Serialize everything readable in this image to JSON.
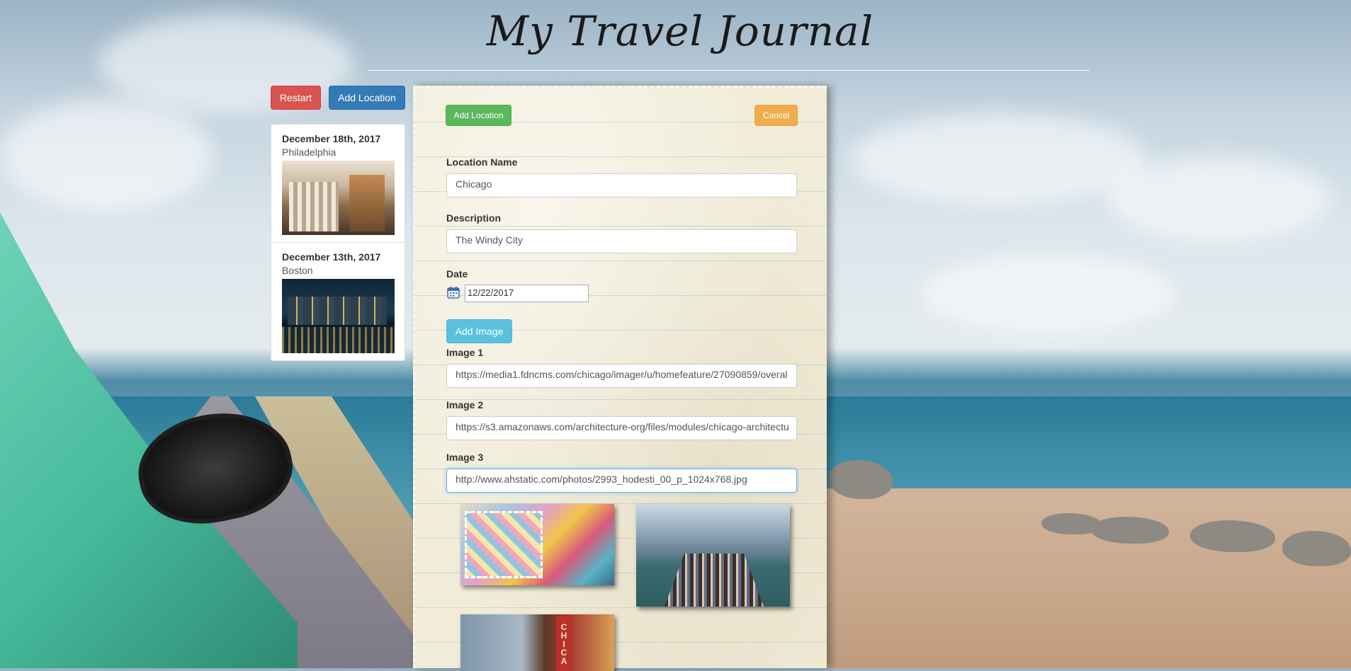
{
  "header": {
    "title": "My Travel Journal"
  },
  "toolbar": {
    "restart_label": "Restart",
    "add_location_label": "Add Location"
  },
  "locations": [
    {
      "date": "December 18th, 2017",
      "city": "Philadelphia"
    },
    {
      "date": "December 13th, 2017",
      "city": "Boston"
    }
  ],
  "form": {
    "add_location_label": "Add Location",
    "cancel_label": "Cancel",
    "location_name_label": "Location Name",
    "location_name_value": "Chicago",
    "description_label": "Description",
    "description_value": "The Windy City",
    "date_label": "Date",
    "date_value": "12/22/2017",
    "add_image_label": "Add Image",
    "images": [
      {
        "label": "Image 1",
        "url": "https://media1.fdncms.com/chicago/imager/u/homefeature/27090859/overal"
      },
      {
        "label": "Image 2",
        "url": "https://s3.amazonaws.com/architecture-org/files/modules/chicago-architectu"
      },
      {
        "label": "Image 3",
        "url": "http://www.ahstatic.com/photos/2993_hodesti_00_p_1024x768.jpg"
      }
    ]
  },
  "colors": {
    "restart": "#d9534f",
    "add_location_primary": "#337ab7",
    "add_location_success": "#5cb85c",
    "cancel_warning": "#f0ad4e",
    "add_image_info": "#5bc0de"
  }
}
